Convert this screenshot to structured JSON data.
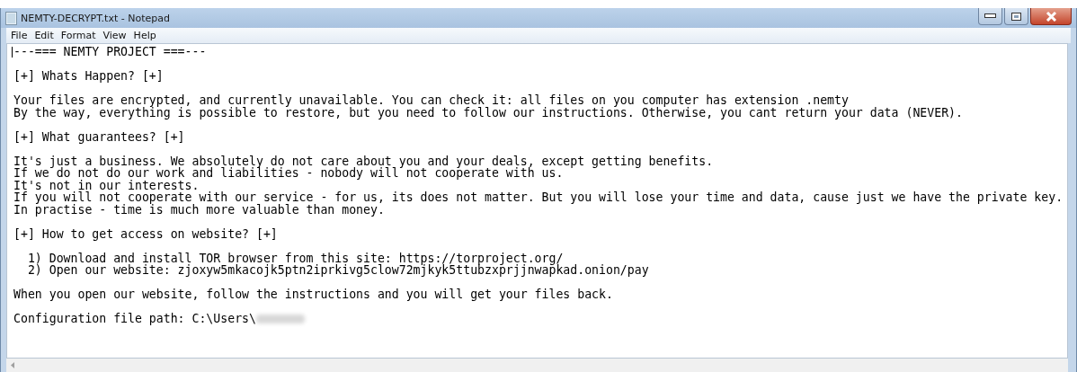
{
  "window": {
    "title": "NEMTY-DECRYPT.txt - Notepad"
  },
  "menu": [
    "File",
    "Edit",
    "Format",
    "View",
    "Help"
  ],
  "blocks": [
    [
      "---=== NEMTY PROJECT ===---"
    ],
    [
      "[+] Whats Happen? [+]"
    ],
    [
      "Your files are encrypted, and currently unavailable. You can check it: all files on you computer has extension .nemty",
      "By the way, everything is possible to restore, but you need to follow our instructions. Otherwise, you cant return your data (NEVER)."
    ],
    [
      "[+] What guarantees? [+]"
    ],
    [
      "It's just a business. We absolutely do not care about you and your deals, except getting benefits.",
      "If we do not do our work and liabilities - nobody will not cooperate with us.",
      "It's not in our interests.",
      "If you will not cooperate with our service - for us, its does not matter. But you will lose your time and data, cause just we have the private key.",
      "In practise - time is much more valuable than money."
    ],
    [
      "[+] How to get access on website? [+]"
    ],
    [
      "  1) Download and install TOR browser from this site: https://torproject.org/",
      "  2) Open our website: zjoxyw5mkacojk5ptn2iprkivg5clow72mjkyk5ttubzxprjjnwapkad.onion/pay"
    ],
    [
      "When you open our website, follow the instructions and you will get your files back."
    ]
  ],
  "config_path": {
    "text": "Configuration file path: C:\\Users\\",
    "redacted": true
  }
}
